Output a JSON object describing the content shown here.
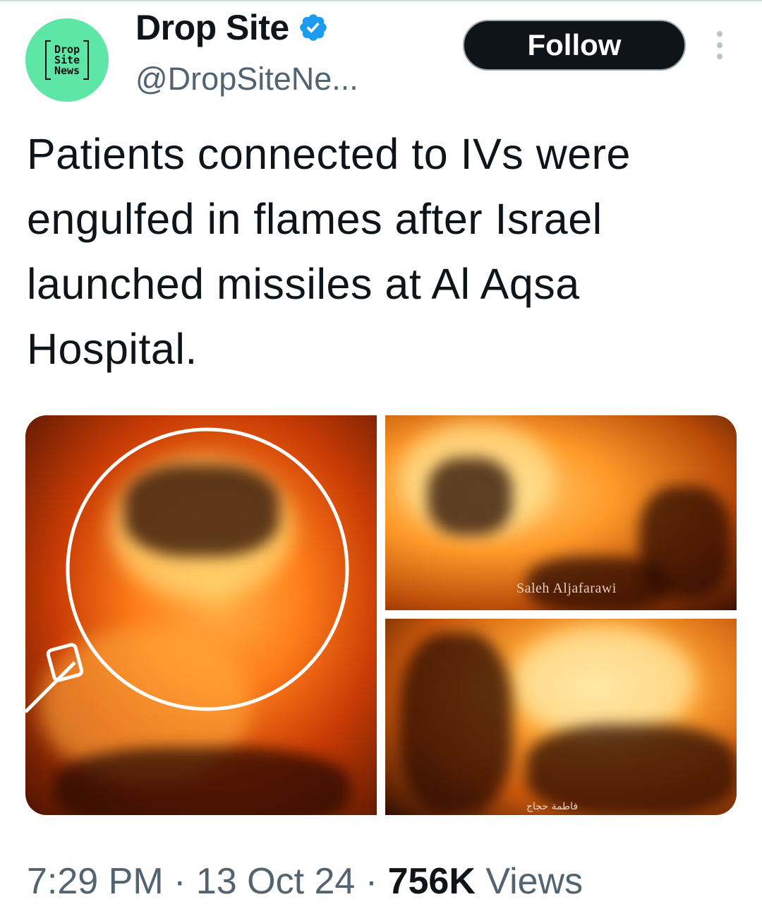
{
  "author": {
    "logo_lines": [
      "Drop",
      "Site",
      "News"
    ],
    "display_name": "Drop Site",
    "handle": "@DropSiteNe...",
    "verified": true,
    "verified_color": "#1d9bf0",
    "avatar_color": "#5de6a6"
  },
  "actions": {
    "follow_label": "Follow",
    "more_icon": "more-vertical-icon"
  },
  "tweet": {
    "text": "Patients connected to IVs were engulfed in flames after Israel launched missiles at Al Aqsa Hospital."
  },
  "media": {
    "photos": [
      {
        "description_icon": "photo"
      },
      {
        "watermark": "Saleh Aljafarawi"
      },
      {
        "watermark": "فاطمة حجاج"
      }
    ]
  },
  "footer": {
    "time": "7:29 PM",
    "sep1": " · ",
    "date": "13 Oct 24",
    "sep2": " · ",
    "views_count": "756K",
    "views_label": " Views"
  }
}
